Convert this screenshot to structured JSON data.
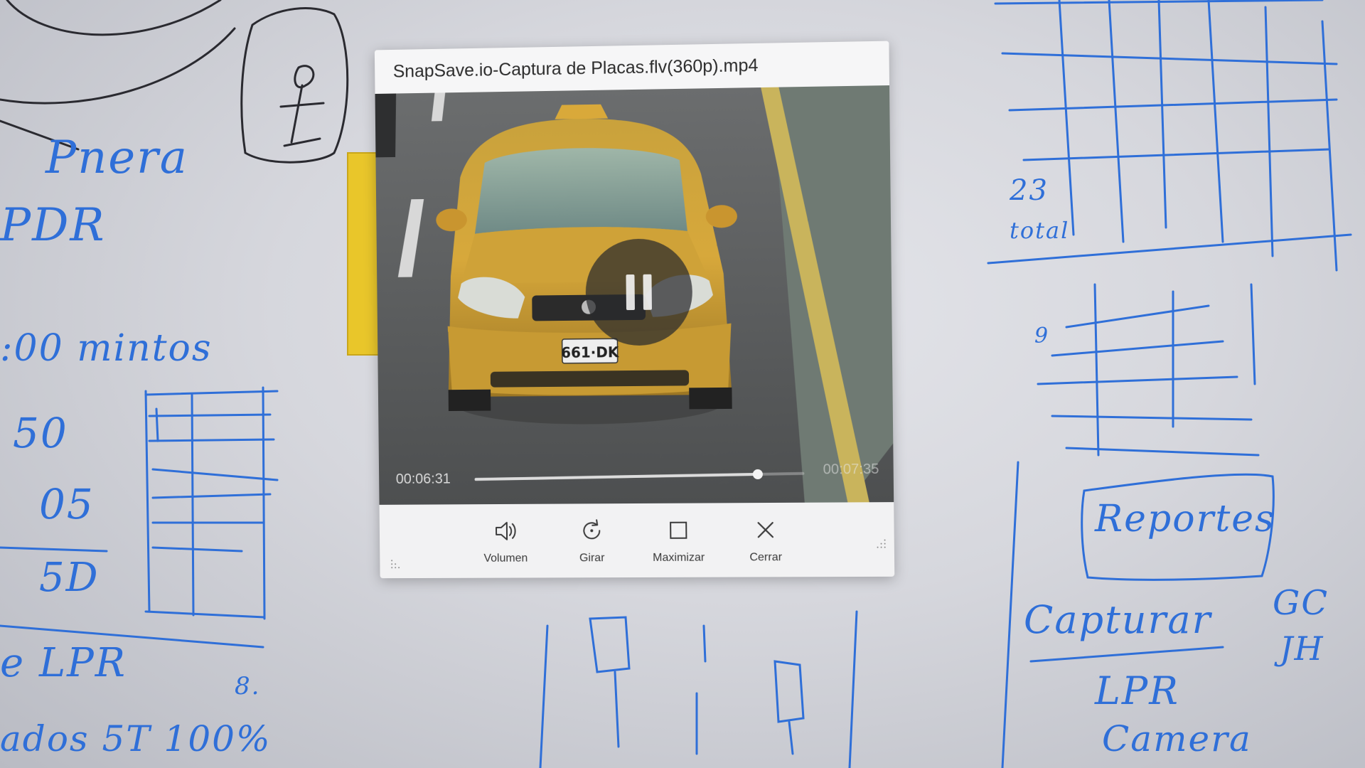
{
  "window": {
    "title": "SnapSave.io-Captura de Placas.flv(360p).mp4"
  },
  "video": {
    "plate_text": "661·DK",
    "current_time": "00:06:31",
    "total_time": "00:07:35",
    "progress_fraction": 0.86,
    "state": "playing",
    "overlay_icon": "pause-icon"
  },
  "controls": [
    {
      "label": "Volumen",
      "icon": "speaker-icon"
    },
    {
      "label": "Girar",
      "icon": "rotate-icon"
    },
    {
      "label": "Maximizar",
      "icon": "maximize-icon"
    },
    {
      "label": "Cerrar",
      "icon": "close-icon"
    }
  ],
  "whiteboard": {
    "notes": {
      "n1": "Pnera",
      "n2": "PDR",
      "n3": ":00 mintos",
      "n4": "50",
      "n5": "05",
      "n6": "5D",
      "n7": "e LPR",
      "n8": "8.",
      "n9": "ados  5T  100%",
      "n10": "23",
      "n11": "total",
      "n12": "Reportes",
      "n13": "Capturar",
      "n14": "GC",
      "n15": "JH",
      "n16": "LPR",
      "n17": "Camera",
      "n18": "9"
    },
    "ink_color": "#2f6fd8"
  }
}
